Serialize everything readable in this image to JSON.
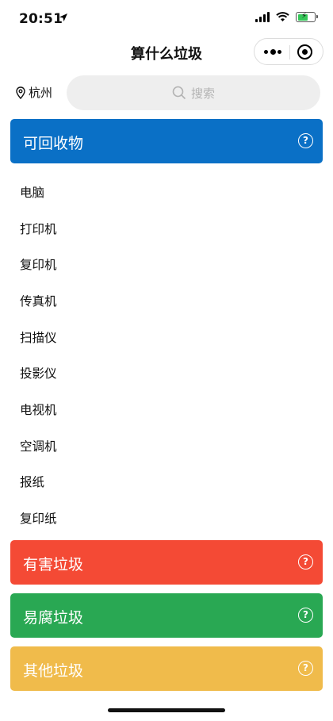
{
  "status_bar": {
    "time": "20:51",
    "battery_level": 0.55,
    "battery_color": "#35c759"
  },
  "nav": {
    "title": "算什么垃圾",
    "more_icon": "more-dots-icon",
    "close_icon": "target-circle-icon"
  },
  "location": {
    "city": "杭州",
    "icon": "map-pin-icon"
  },
  "search": {
    "placeholder": "搜索",
    "icon": "search-icon"
  },
  "categories": [
    {
      "label": "可回收物",
      "color": "#0a70c6",
      "help_icon": "question-circle-icon"
    },
    {
      "label": "有害垃圾",
      "color": "#f44a35",
      "help_icon": "question-circle-icon"
    },
    {
      "label": "易腐垃圾",
      "color": "#29a853",
      "help_icon": "question-circle-icon"
    },
    {
      "label": "其他垃圾",
      "color": "#f0bb4b",
      "help_icon": "question-circle-icon"
    }
  ],
  "recyclable_items": [
    "电脑",
    "打印机",
    "复印机",
    "传真机",
    "扫描仪",
    "投影仪",
    "电视机",
    "空调机",
    "报纸",
    "复印纸"
  ]
}
